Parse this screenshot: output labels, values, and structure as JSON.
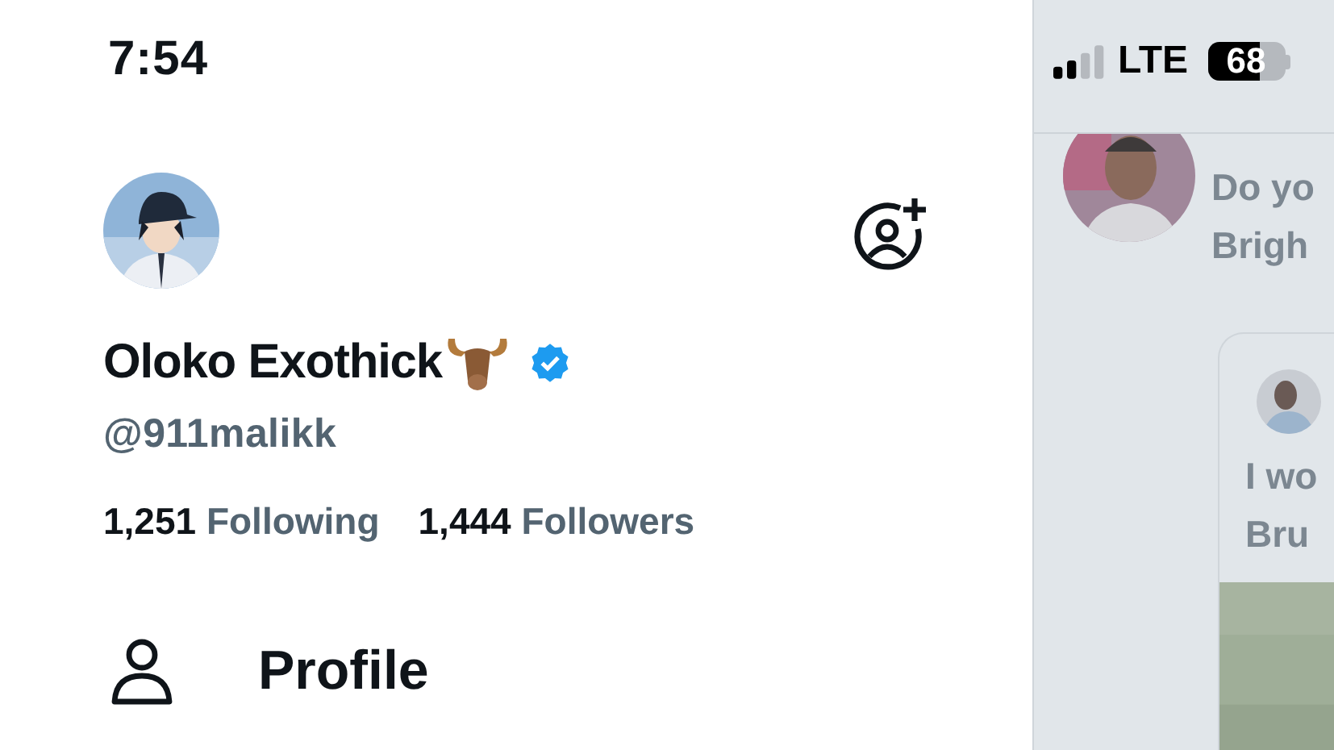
{
  "status_bar": {
    "time": "7:54",
    "network": "LTE",
    "battery": {
      "text": "68",
      "level": 0.68
    }
  },
  "profile": {
    "name": "Oloko Exothick",
    "verified": true,
    "handle": "@911malikk",
    "stats": [
      {
        "count": "1,251",
        "label": "Following"
      },
      {
        "count": "1,444",
        "label": "Followers"
      }
    ]
  },
  "menu": [
    {
      "label": "Profile"
    }
  ],
  "feed_peek": {
    "post_lines": [
      "Do yo",
      "Brigh"
    ],
    "quote_lines": [
      "I wo",
      "Bru"
    ]
  }
}
